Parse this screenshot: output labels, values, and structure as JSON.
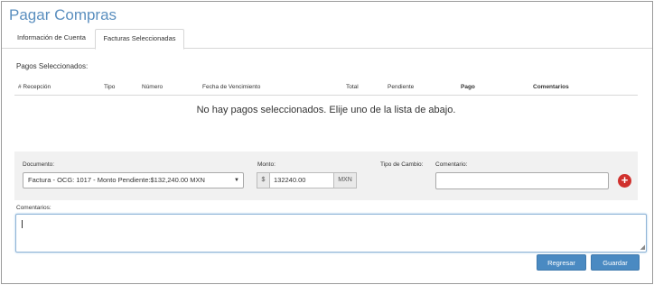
{
  "page": {
    "title": "Pagar Compras"
  },
  "tabs": [
    {
      "label": "Información de Cuenta",
      "active": false
    },
    {
      "label": "Facturas Seleccionadas",
      "active": true
    }
  ],
  "selected_payments": {
    "label": "Pagos Seleccionados:",
    "columns": [
      "# Recepción",
      "Tipo",
      "Número",
      "Fecha de Vencimiento",
      "Total",
      "Pendiente",
      "Pago",
      "Comentarios"
    ],
    "empty_message": "No hay pagos seleccionados. Elije uno de la lista de abajo."
  },
  "form": {
    "documento_label": "Documento:",
    "documento_value": "Factura - OCG: 1017 - Monto Pendiente:$132,240.00 MXN",
    "monto_label": "Monto:",
    "monto_prefix": "$",
    "monto_value": "132240.00",
    "monto_currency": "MXN",
    "tipo_cambio_label": "Tipo de Cambio:",
    "comentario_label": "Comentario:",
    "comentario_value": ""
  },
  "comments": {
    "label": "Comentarios:",
    "value": ""
  },
  "buttons": {
    "regresar": "Regresar",
    "guardar": "Guardar"
  },
  "colors": {
    "title": "#5b8fbf",
    "button": "#4a8ac2",
    "add_icon": "#d0312d"
  }
}
